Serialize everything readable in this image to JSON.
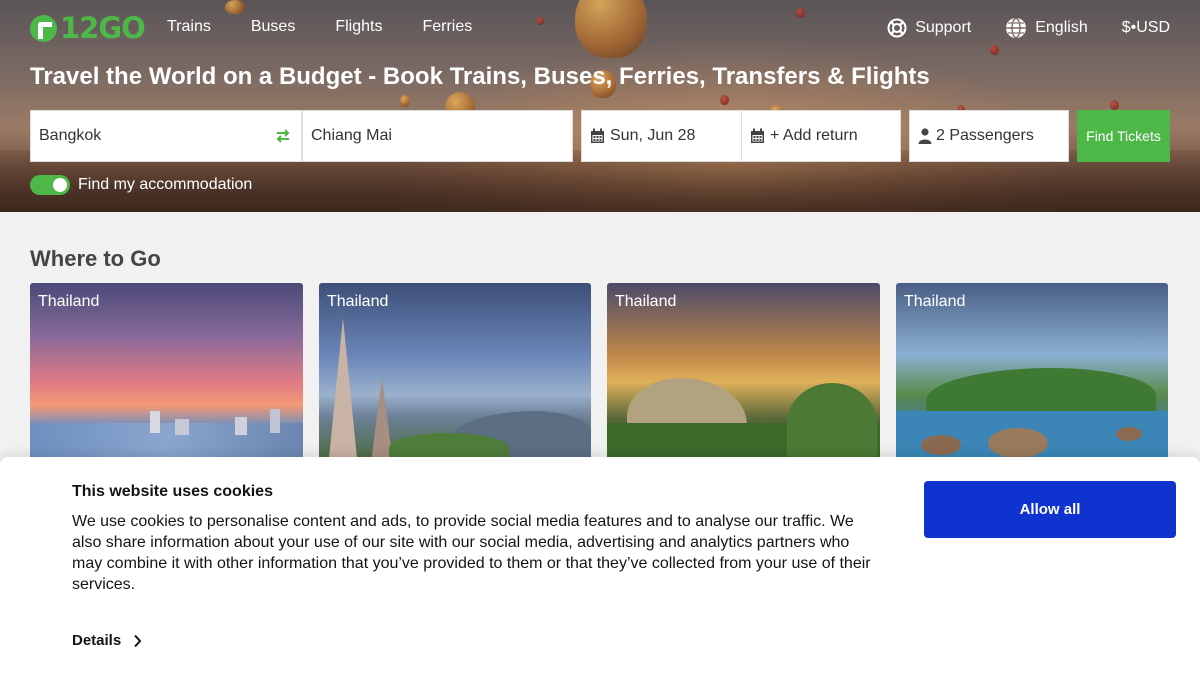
{
  "header": {
    "logo_text": "12GO",
    "nav": [
      "Trains",
      "Buses",
      "Flights",
      "Ferries"
    ],
    "support": "Support",
    "language": "English",
    "currency": "$•USD"
  },
  "hero": {
    "headline": "Travel the World on a Budget - Book Trains, Buses, Ferries, Transfers & Flights"
  },
  "search": {
    "from": "Bangkok",
    "to": "Chiang Mai",
    "date": "Sun, Jun 28",
    "return": "+ Add return",
    "passengers": "2 Passengers",
    "find_button": "Find Tickets",
    "accommodation_label": "Find my accommodation",
    "accommodation_enabled": true
  },
  "where_to_go": {
    "title": "Where to Go",
    "cards": [
      {
        "country": "Thailand"
      },
      {
        "country": "Thailand"
      },
      {
        "country": "Thailand"
      },
      {
        "country": "Thailand"
      }
    ]
  },
  "cookie_banner": {
    "title": "This website uses cookies",
    "text": "We use cookies to personalise content and ads, to provide social media features and to analyse our traffic. We also share information about your use of our site with our social media, advertising and analytics partners who may combine it with other information that you’ve provided to them or that they’ve collected from your use of their services.",
    "details": "Details",
    "allow_all": "Allow all"
  },
  "colors": {
    "brand_green": "#4db848",
    "allow_blue": "#1032cf"
  },
  "icons": [
    "support-lifebuoy-icon",
    "globe-icon",
    "swap-icon",
    "calendar-icon",
    "person-icon",
    "chevron-right-icon"
  ]
}
